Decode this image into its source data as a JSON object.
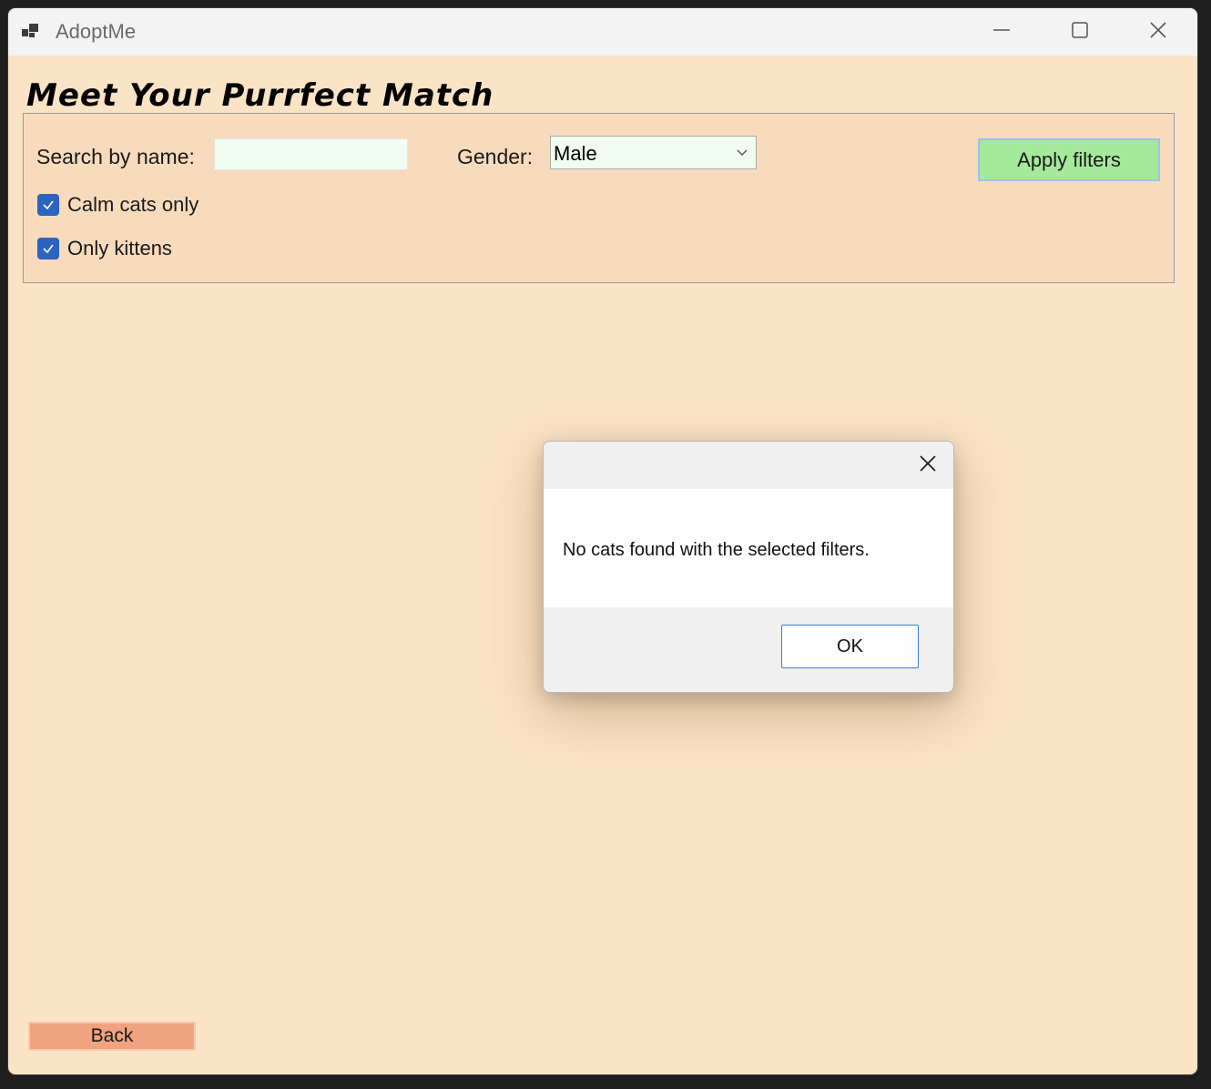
{
  "window": {
    "title": "AdoptMe",
    "icons": [
      "app-icon",
      "minimize-icon",
      "maximize-icon",
      "close-icon"
    ]
  },
  "page": {
    "title": "Meet Your Purrfect Match"
  },
  "filters": {
    "search_label": "Search by name:",
    "search_value": "",
    "gender_label": "Gender:",
    "gender_value": "Male",
    "apply_label": "Apply filters",
    "calm_label": "Calm cats only",
    "calm_checked": true,
    "kittens_label": "Only kittens",
    "kittens_checked": true
  },
  "footer": {
    "back_label": "Back"
  },
  "dialog": {
    "message": "No cats found with the selected filters.",
    "ok_label": "OK"
  },
  "colors": {
    "background": "#fbe3c6",
    "filter_panel": "#f8dbbd",
    "apply_button": "#a5e99b",
    "back_button": "#f1a27f",
    "input_background": "#f1fdf1",
    "checkbox_accent": "#2a63c2"
  }
}
